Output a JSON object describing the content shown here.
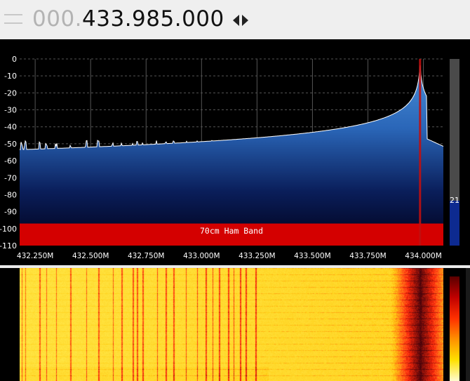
{
  "frequency": {
    "leading_zeros": "000.",
    "value": "433.985.000"
  },
  "spectrum": {
    "y_axis": {
      "min": -110,
      "max": 0,
      "ticks": [
        "0",
        "-10",
        "-20",
        "-30",
        "-40",
        "-50",
        "-60",
        "-70",
        "-80",
        "-90",
        "-100",
        "-110"
      ]
    },
    "x_axis": {
      "min_hz": 432180000,
      "max_hz": 434090000,
      "ticks": [
        {
          "hz": 432250000,
          "label": "432.250M"
        },
        {
          "hz": 432500000,
          "label": "432.500M"
        },
        {
          "hz": 432750000,
          "label": "432.750M"
        },
        {
          "hz": 433000000,
          "label": "433.000M"
        },
        {
          "hz": 433250000,
          "label": "433.250M"
        },
        {
          "hz": 433500000,
          "label": "433.500M"
        },
        {
          "hz": 433750000,
          "label": "433.750M"
        },
        {
          "hz": 434000000,
          "label": "434.000M"
        }
      ]
    },
    "band_label": "70cm Ham Band",
    "band_color": "#d40000",
    "trace_color": "#ffffff",
    "fill_top_color": "#4a8fd8",
    "fill_bottom_color": "#000018",
    "tuned_hz": 433985000,
    "squelch_level": "21",
    "level_fraction": 0.24
  }
}
